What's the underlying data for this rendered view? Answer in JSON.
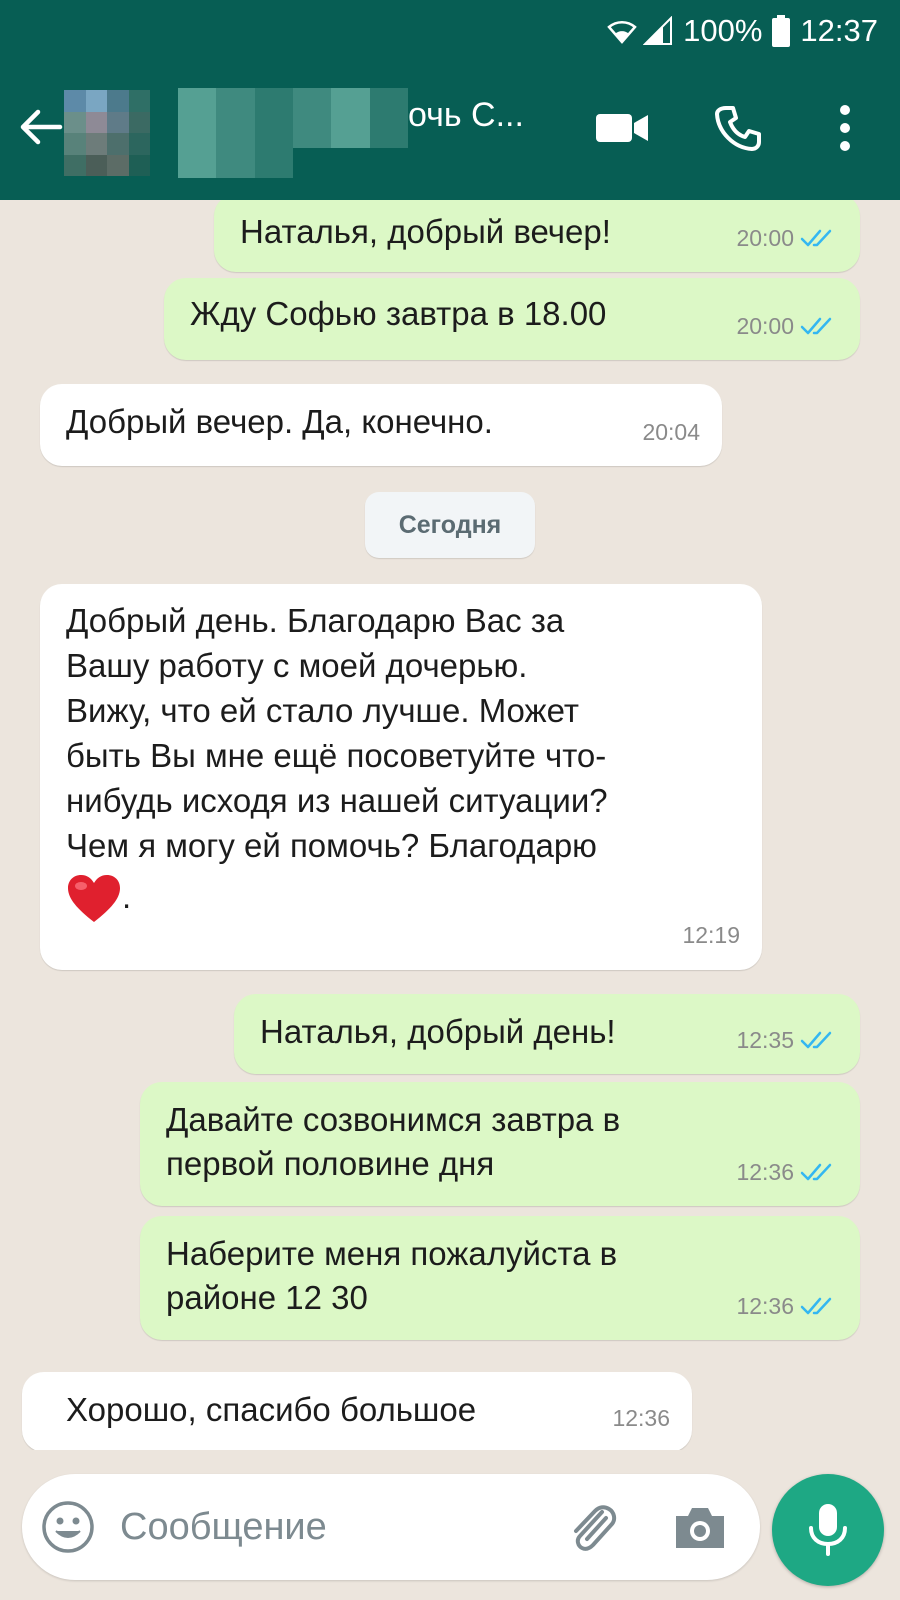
{
  "status_bar": {
    "battery": "100%",
    "time": "12:37"
  },
  "header": {
    "contact_name_visible": "очь С..."
  },
  "messages": [
    {
      "direction": "outgoing",
      "text": "Наталья, добрый вечер!",
      "time": "20:00",
      "read": true
    },
    {
      "direction": "outgoing",
      "text": "Жду Софью завтра в 18.00",
      "time": "20:00",
      "read": true
    },
    {
      "direction": "incoming",
      "text": "Добрый вечер. Да, конечно.",
      "time": "20:04"
    },
    {
      "direction": "incoming",
      "lines": [
        "Добрый день. Благодарю Вас за",
        "Вашу работу с моей дочерью.",
        "Вижу, что ей стало лучше. Может",
        "быть Вы мне ещё посоветуйте что-",
        "нибудь исходя из нашей ситуации?",
        "Чем я могу ей помочь? Благодарю"
      ],
      "trailing": ".",
      "emoji": "red-heart",
      "time": "12:19"
    },
    {
      "direction": "outgoing",
      "text": "Наталья, добрый день!",
      "time": "12:35",
      "read": true
    },
    {
      "direction": "outgoing",
      "lines": [
        "Давайте созвонимся завтра в",
        "первой половине дня"
      ],
      "time": "12:36",
      "read": true
    },
    {
      "direction": "outgoing",
      "lines": [
        "Наберите меня пожалуйста в",
        "районе 12 30"
      ],
      "time": "12:36",
      "read": true
    },
    {
      "direction": "incoming",
      "text": "Хорошо, спасибо большое",
      "time": "12:36"
    }
  ],
  "day_divider": "Сегодня",
  "composer": {
    "placeholder": "Сообщение"
  },
  "colors": {
    "header": "#075e54",
    "outgoing_bubble": "#dcf8c6",
    "incoming_bubble": "#ffffff",
    "read_tick": "#34b7f1",
    "mic_button": "#1ea884"
  }
}
